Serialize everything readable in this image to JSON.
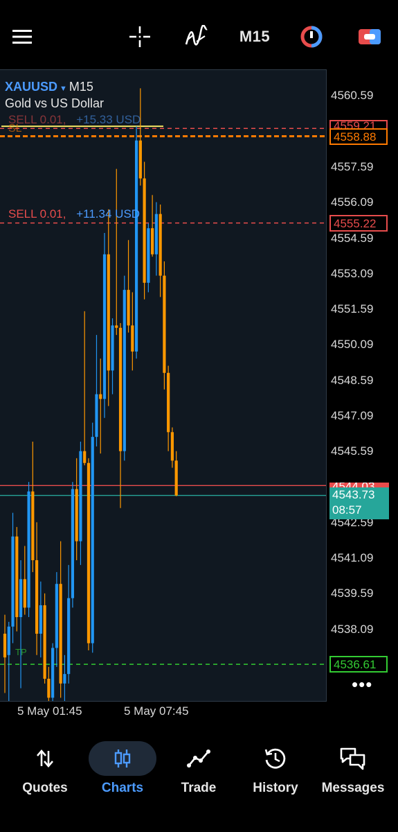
{
  "toolbar": {
    "menu_icon": "hamburger-menu-icon",
    "crosshair_icon": "crosshair-icon",
    "indicators_icon": "indicators-icon",
    "timeframe": "M15",
    "objects_icon": "objects-icon",
    "trade_icon": "one-click-trading-icon"
  },
  "chart": {
    "symbol": "XAUUSD",
    "timeframe": "M15",
    "description": "Gold vs US Dollar",
    "price_ticks": [
      "4560.59",
      "4557.59",
      "4556.09",
      "4554.59",
      "4553.09",
      "4551.59",
      "4550.09",
      "4548.59",
      "4547.09",
      "4545.59",
      "4542.59",
      "4541.09",
      "4539.59",
      "4538.09"
    ],
    "time_labels": [
      "5 May 01:45",
      "5 May 07:45"
    ],
    "badges": {
      "sell1_level": "4559.21",
      "sl_level": "4558.88",
      "sell2_level": "4555.22",
      "ask_partial": "4544.03",
      "bid": "4543.73",
      "countdown": "08:57",
      "tp_level": "4536.61"
    },
    "order_labels": {
      "sell1": "SELL 0.01,",
      "sell1_profit": "+15.33 USD",
      "sl": "SL",
      "sell2": "SELL 0.01,",
      "sell2_profit": "+11.34 USD",
      "tp": "TP"
    },
    "more_label": "•••",
    "colors": {
      "bull": "#2196f3",
      "bear": "#ff9800",
      "sell": "#e84c4c",
      "sl": "#ff7a00",
      "tp": "#33cc33",
      "bid": "#26a69a",
      "ask": "#e84c4c",
      "background": "#101821"
    }
  },
  "chart_data": {
    "type": "candlestick",
    "timeframe": "M15",
    "ylim": [
      4535.0,
      4561.5
    ],
    "x_labels": [
      "5 May 01:45",
      "5 May 07:45"
    ],
    "candles": [
      {
        "o": 4537.9,
        "h": 4538.7,
        "l": 4535.4,
        "c": 4536.9
      },
      {
        "o": 4537.0,
        "h": 4538.4,
        "l": 4535.0,
        "c": 4538.2
      },
      {
        "o": 4538.2,
        "h": 4543.0,
        "l": 4537.5,
        "c": 4542.0
      },
      {
        "o": 4542.0,
        "h": 4542.4,
        "l": 4538.0,
        "c": 4538.6
      },
      {
        "o": 4538.6,
        "h": 4541.0,
        "l": 4535.6,
        "c": 4540.2
      },
      {
        "o": 4540.2,
        "h": 4541.6,
        "l": 4538.7,
        "c": 4539.0
      },
      {
        "o": 4539.0,
        "h": 4544.3,
        "l": 4538.6,
        "c": 4543.9
      },
      {
        "o": 4543.9,
        "h": 4546.0,
        "l": 4540.5,
        "c": 4541.0
      },
      {
        "o": 4541.0,
        "h": 4542.6,
        "l": 4537.0,
        "c": 4537.9
      },
      {
        "o": 4537.9,
        "h": 4540.1,
        "l": 4536.9,
        "c": 4539.1
      },
      {
        "o": 4539.1,
        "h": 4539.6,
        "l": 4535.8,
        "c": 4536.0
      },
      {
        "o": 4536.0,
        "h": 4536.5,
        "l": 4535.0,
        "c": 4535.2
      },
      {
        "o": 4535.2,
        "h": 4537.5,
        "l": 4535.0,
        "c": 4537.3
      },
      {
        "o": 4537.3,
        "h": 4540.5,
        "l": 4536.5,
        "c": 4540.0
      },
      {
        "o": 4540.0,
        "h": 4541.8,
        "l": 4535.2,
        "c": 4535.8
      },
      {
        "o": 4535.8,
        "h": 4537.0,
        "l": 4535.0,
        "c": 4536.2
      },
      {
        "o": 4536.2,
        "h": 4540.8,
        "l": 4535.8,
        "c": 4539.4
      },
      {
        "o": 4539.4,
        "h": 4544.3,
        "l": 4539.0,
        "c": 4544.0
      },
      {
        "o": 4544.0,
        "h": 4545.3,
        "l": 4541.0,
        "c": 4541.8
      },
      {
        "o": 4541.8,
        "h": 4546.0,
        "l": 4540.8,
        "c": 4545.6
      },
      {
        "o": 4545.6,
        "h": 4551.5,
        "l": 4545.0,
        "c": 4545.1
      },
      {
        "o": 4545.1,
        "h": 4545.3,
        "l": 4537.2,
        "c": 4537.5
      },
      {
        "o": 4537.5,
        "h": 4546.8,
        "l": 4537.1,
        "c": 4546.2
      },
      {
        "o": 4546.2,
        "h": 4550.5,
        "l": 4545.8,
        "c": 4548.0
      },
      {
        "o": 4548.0,
        "h": 4549.5,
        "l": 4545.5,
        "c": 4547.8
      },
      {
        "o": 4547.8,
        "h": 4554.8,
        "l": 4547.0,
        "c": 4553.9
      },
      {
        "o": 4553.9,
        "h": 4555.8,
        "l": 4547.5,
        "c": 4549.0
      },
      {
        "o": 4549.0,
        "h": 4551.2,
        "l": 4548.0,
        "c": 4550.9
      },
      {
        "o": 4550.9,
        "h": 4557.5,
        "l": 4550.5,
        "c": 4550.8
      },
      {
        "o": 4550.8,
        "h": 4551.0,
        "l": 4543.2,
        "c": 4545.6
      },
      {
        "o": 4545.6,
        "h": 4553.0,
        "l": 4545.2,
        "c": 4552.4
      },
      {
        "o": 4552.4,
        "h": 4554.5,
        "l": 4550.6,
        "c": 4550.9
      },
      {
        "o": 4550.9,
        "h": 4552.3,
        "l": 4549.0,
        "c": 4549.8
      },
      {
        "o": 4549.8,
        "h": 4559.3,
        "l": 4549.5,
        "c": 4558.7
      },
      {
        "o": 4558.7,
        "h": 4560.9,
        "l": 4556.8,
        "c": 4557.1
      },
      {
        "o": 4557.1,
        "h": 4557.8,
        "l": 4552.0,
        "c": 4552.7
      },
      {
        "o": 4552.7,
        "h": 4555.2,
        "l": 4552.3,
        "c": 4555.0
      },
      {
        "o": 4555.0,
        "h": 4556.4,
        "l": 4553.8,
        "c": 4553.9
      },
      {
        "o": 4553.9,
        "h": 4556.1,
        "l": 4553.0,
        "c": 4555.6
      },
      {
        "o": 4555.6,
        "h": 4556.0,
        "l": 4552.1,
        "c": 4553.0
      },
      {
        "o": 4553.0,
        "h": 4553.6,
        "l": 4548.2,
        "c": 4548.9
      },
      {
        "o": 4548.9,
        "h": 4549.2,
        "l": 4545.6,
        "c": 4546.4
      },
      {
        "o": 4546.4,
        "h": 4546.6,
        "l": 4544.9,
        "c": 4545.2
      },
      {
        "o": 4545.2,
        "h": 4545.6,
        "l": 4543.7,
        "c": 4543.73
      }
    ],
    "levels": [
      {
        "name": "SELL 0.01 entry",
        "price": 4559.21
      },
      {
        "name": "SL",
        "price": 4558.88
      },
      {
        "name": "SELL 0.01 entry",
        "price": 4555.22
      },
      {
        "name": "Ask",
        "price": 4544.03
      },
      {
        "name": "Bid",
        "price": 4543.73
      },
      {
        "name": "TP",
        "price": 4536.61
      }
    ]
  },
  "nav": {
    "items": [
      {
        "label": "Quotes",
        "icon": "quotes-arrows-icon"
      },
      {
        "label": "Charts",
        "icon": "candlestick-icon"
      },
      {
        "label": "Trade",
        "icon": "trade-line-icon"
      },
      {
        "label": "History",
        "icon": "history-clock-icon"
      },
      {
        "label": "Messages",
        "icon": "messages-icon"
      }
    ],
    "active": "Charts"
  }
}
